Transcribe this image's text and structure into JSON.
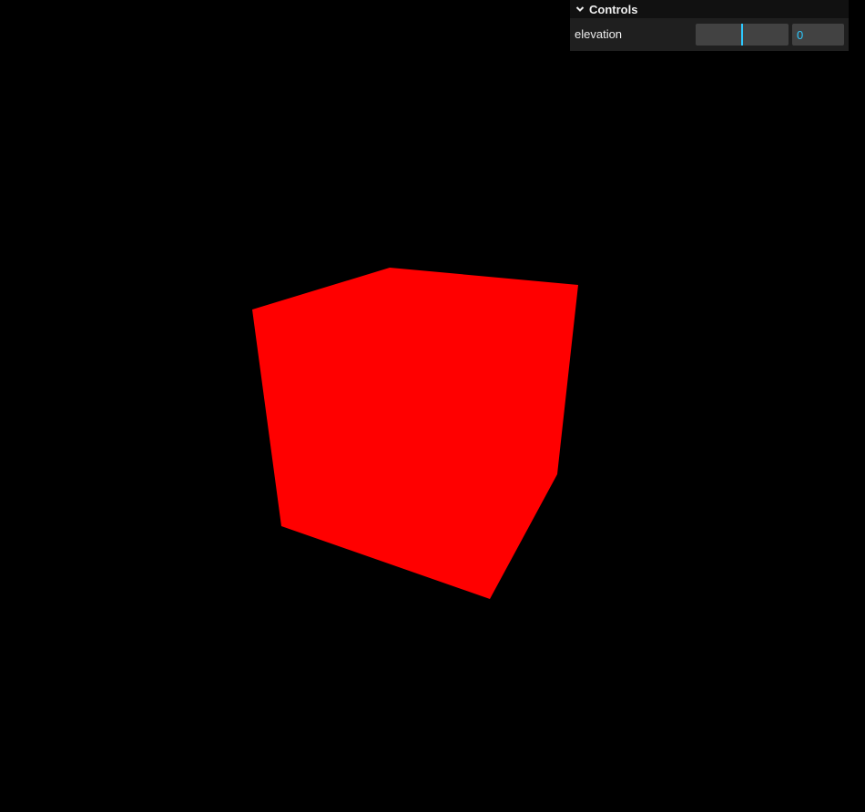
{
  "gui": {
    "title": "Controls",
    "controls": [
      {
        "label": "elevation",
        "value": "0",
        "slider_fraction": 0.5,
        "accent_color": "#2cc9ff"
      }
    ]
  },
  "scene": {
    "background_color": "#000000",
    "object": "cube",
    "object_color": "#ff0000"
  }
}
